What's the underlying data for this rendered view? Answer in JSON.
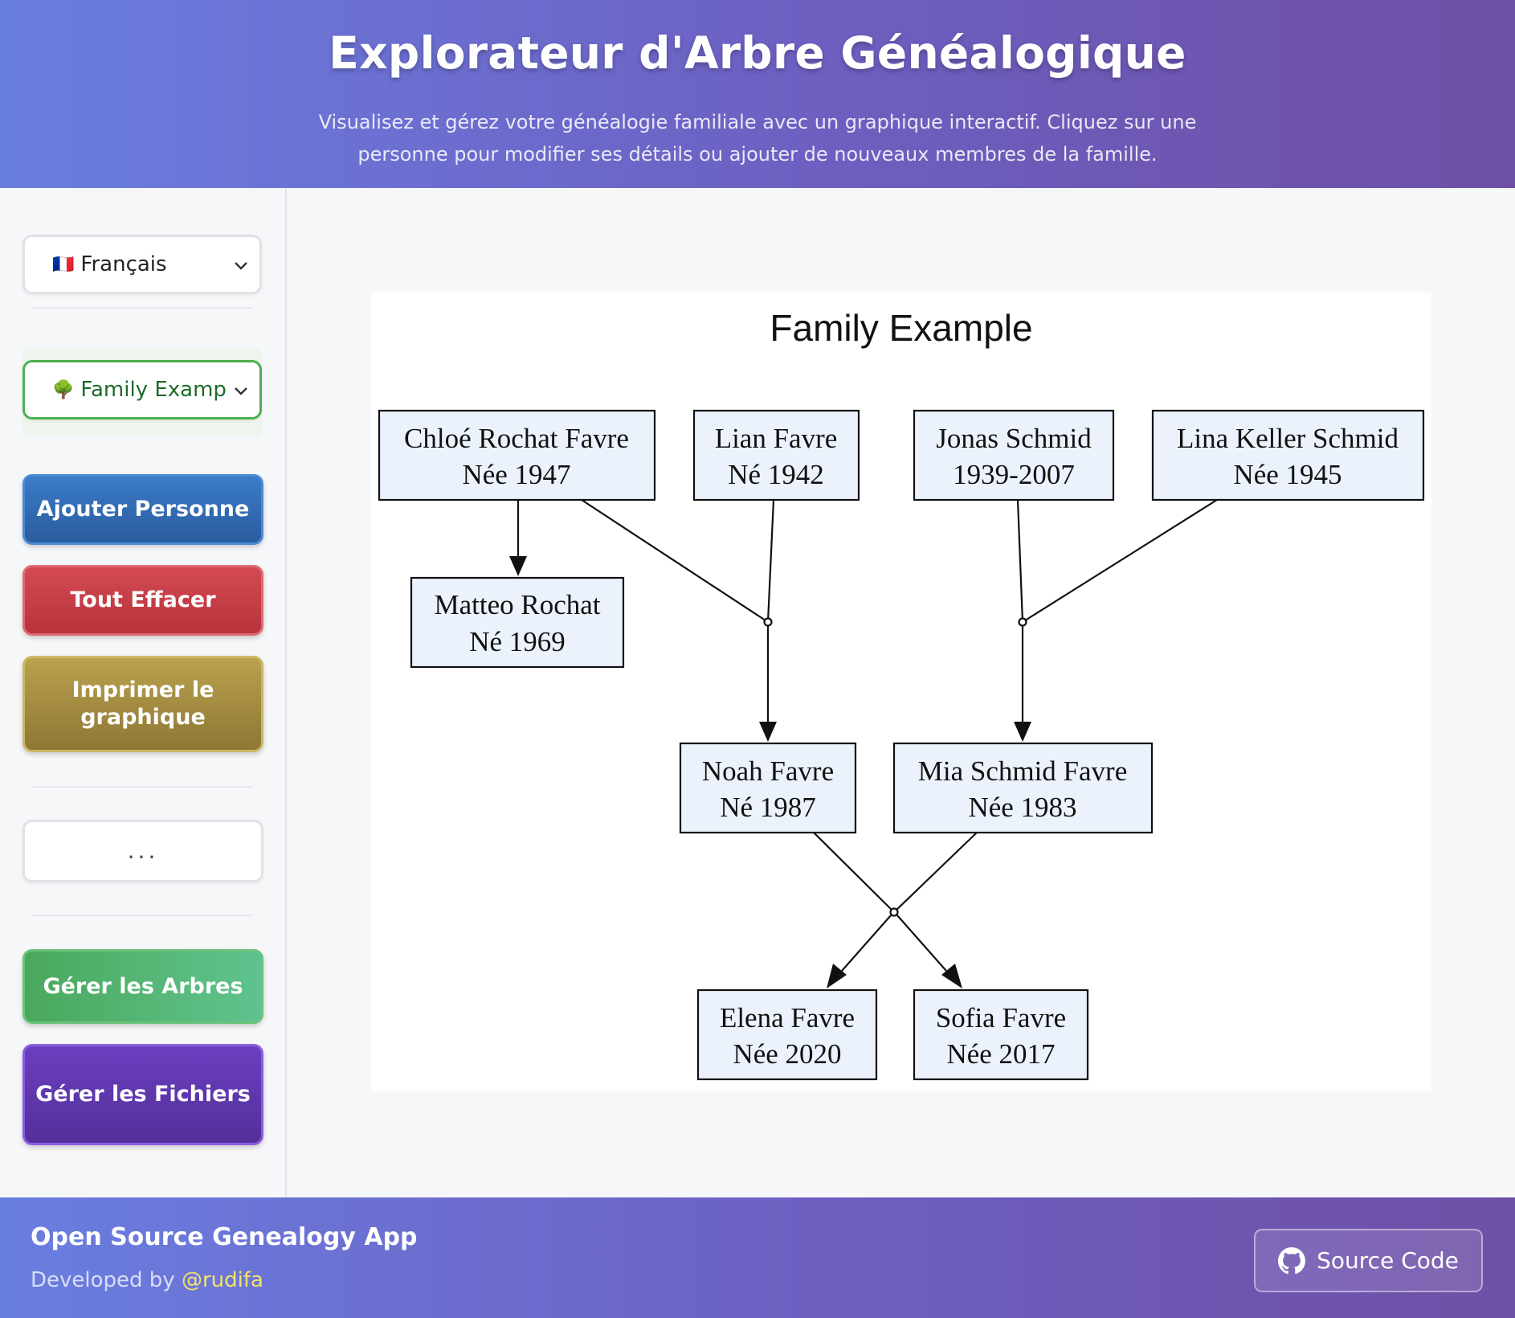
{
  "header": {
    "title": "Explorateur d'Arbre Généalogique",
    "subtitle": "Visualisez et gérez votre généalogie familiale avec un graphique interactif. Cliquez sur une personne pour modifier ses détails ou ajouter de nouveaux membres de la famille."
  },
  "sidebar": {
    "language": {
      "flag": "🇫🇷",
      "selected": "Français"
    },
    "tree_select": {
      "icon": "🌳",
      "selected": "Family Examp"
    },
    "buttons": {
      "add_person": "Ajouter Personne",
      "clear_all": "Tout Effacer",
      "print_chart": "Imprimer le graphique",
      "more": "...",
      "manage_trees": "Gérer les Arbres",
      "manage_files": "Gérer les Fichiers"
    }
  },
  "chart": {
    "title": "Family Example",
    "people": [
      {
        "id": "chloe",
        "name": "Chloé Rochat Favre",
        "dates": "Née 1947"
      },
      {
        "id": "lian",
        "name": "Lian Favre",
        "dates": "Né 1942"
      },
      {
        "id": "jonas",
        "name": "Jonas Schmid",
        "dates": "1939-2007"
      },
      {
        "id": "lina",
        "name": "Lina Keller Schmid",
        "dates": "Née 1945"
      },
      {
        "id": "matteo",
        "name": "Matteo Rochat",
        "dates": "Né 1969"
      },
      {
        "id": "noah",
        "name": "Noah Favre",
        "dates": "Né 1987"
      },
      {
        "id": "mia",
        "name": "Mia Schmid Favre",
        "dates": "Née 1983"
      },
      {
        "id": "elena",
        "name": "Elena Favre",
        "dates": "Née 2020"
      },
      {
        "id": "sofia",
        "name": "Sofia Favre",
        "dates": "Née 2017"
      }
    ],
    "colors": {
      "node_fill": "#ebf2fc",
      "node_stroke": "#111111",
      "edge": "#111111"
    }
  },
  "footer": {
    "title": "Open Source Genealogy App",
    "developed_by": "Developed by",
    "handle": "@rudifa",
    "source_button": "Source Code",
    "source_icon": "github-icon"
  }
}
